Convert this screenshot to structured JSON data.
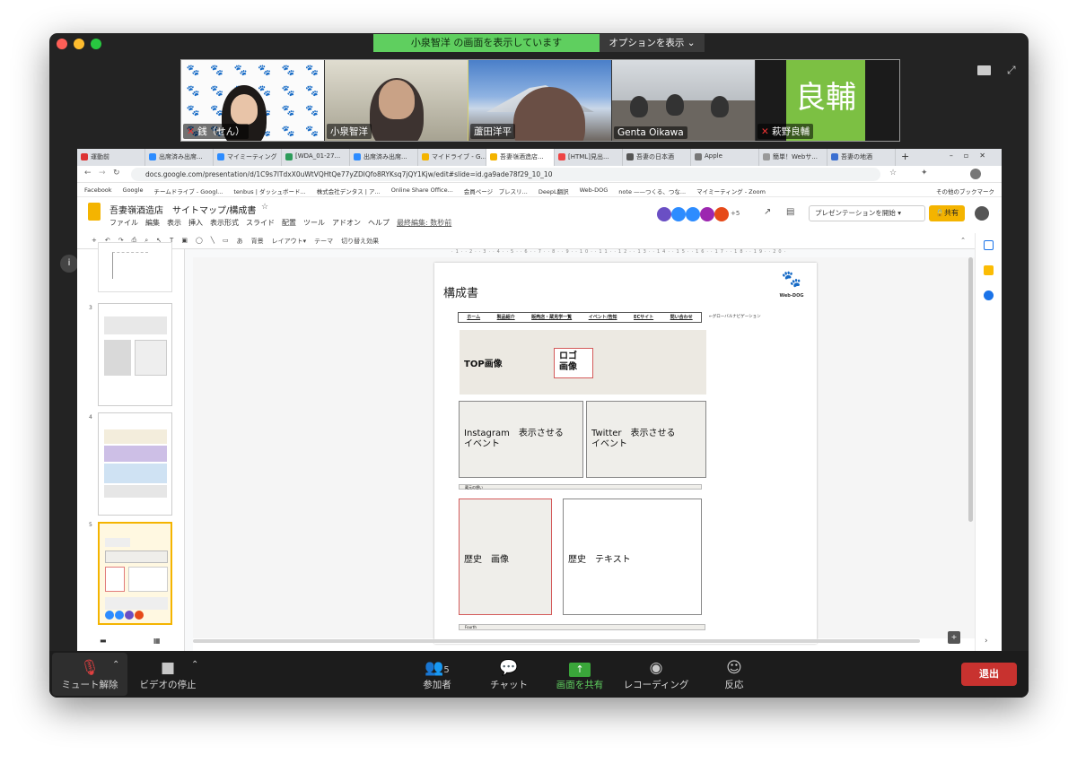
{
  "zoom": {
    "banner": "小泉智洋 の画面を表示しています",
    "options_button": "オプションを表示",
    "participants": [
      {
        "name": "銭（せん）",
        "muted": true,
        "type": "pattern"
      },
      {
        "name": "小泉智洋",
        "muted": false,
        "type": "video",
        "active": true
      },
      {
        "name": "蘆田洋平",
        "muted": false,
        "type": "video"
      },
      {
        "name": "Genta Oikawa",
        "muted": false,
        "type": "video"
      },
      {
        "name": "萩野良輔",
        "muted": true,
        "type": "avatar",
        "avatar_text": "良輔"
      }
    ],
    "controls": {
      "mute": "ミュート解除",
      "video": "ビデオの停止",
      "participants": "参加者",
      "participants_count": "5",
      "chat": "チャット",
      "share": "画面を共有",
      "record": "レコーディング",
      "reactions": "反応",
      "leave": "退出"
    }
  },
  "browser": {
    "tabs": [
      {
        "label": "運動前",
        "color": "#d33"
      },
      {
        "label": "出席済み出席...",
        "color": "#2d8cff"
      },
      {
        "label": "マイミーティング",
        "color": "#2d8cff"
      },
      {
        "label": "[WDA_01-27...",
        "color": "#2d9c5a"
      },
      {
        "label": "出席済み出席...",
        "color": "#2d8cff"
      },
      {
        "label": "マイドライブ - G...",
        "color": "#f4b400"
      },
      {
        "label": "吾妻嶺酒造店...",
        "color": "#f4b400",
        "active": true
      },
      {
        "label": "[HTML]見出...",
        "color": "#e44"
      },
      {
        "label": "吾妻の日本酒",
        "color": "#555"
      },
      {
        "label": "Apple",
        "color": "#777"
      },
      {
        "label": "簡単！Webサ...",
        "color": "#999"
      },
      {
        "label": "吾妻の地酒",
        "color": "#3b6fd1"
      }
    ],
    "url": "docs.google.com/presentation/d/1C9s7lTdxX0uWtVQHtQe77yZDlQfo8RYKsq7jQY1Kjw/edit#slide=id.ga9ade78f29_10_10",
    "bookmarks": [
      "Facebook",
      "Google",
      "チームドライブ - Googl...",
      "tenbus | ダッシュボード...",
      "株式会社デンタス | ア...",
      "Online Share Office...",
      "会員ページ　プレスリ...",
      "DeepL翻訳",
      "Web-DOG",
      "note ——つくる、つな...",
      "マイミーティング - Zoom"
    ],
    "other_bookmarks": "その他のブックマーク"
  },
  "slides": {
    "title": "吾妻嶺酒造店　サイトマップ/構成書",
    "menu": [
      "ファイル",
      "編集",
      "表示",
      "挿入",
      "表示形式",
      "スライド",
      "配置",
      "ツール",
      "アドオン",
      "ヘルプ"
    ],
    "last_edit": "最終編集: 数秒前",
    "present_button": "プレゼンテーションを開始",
    "share_button": "共有",
    "collab_count": "+5",
    "toolbar": [
      "背景",
      "レイアウト▾",
      "テーマ",
      "切り替え効果"
    ],
    "thumb_numbers": [
      "3",
      "4",
      "5"
    ],
    "slide": {
      "heading": "構成書",
      "logo_text": "Web-DOG",
      "nav": [
        "ホーム",
        "製品紹介",
        "販売店・蔵見学一覧",
        "イベント/告知",
        "ECサイト",
        "問い合わせ"
      ],
      "nav_note": "←グローバルナビゲーション",
      "top_image": "TOP画像",
      "logo_image": "ロゴ\n画像",
      "instagram": "Instagram　表示させる\nイベント",
      "twitter": "Twitter　表示させる\nイベント",
      "strip1": "蔵元の想い",
      "history_image": "歴史　画像",
      "history_text": "歴史　テキスト",
      "strip2": "Fourth"
    }
  }
}
